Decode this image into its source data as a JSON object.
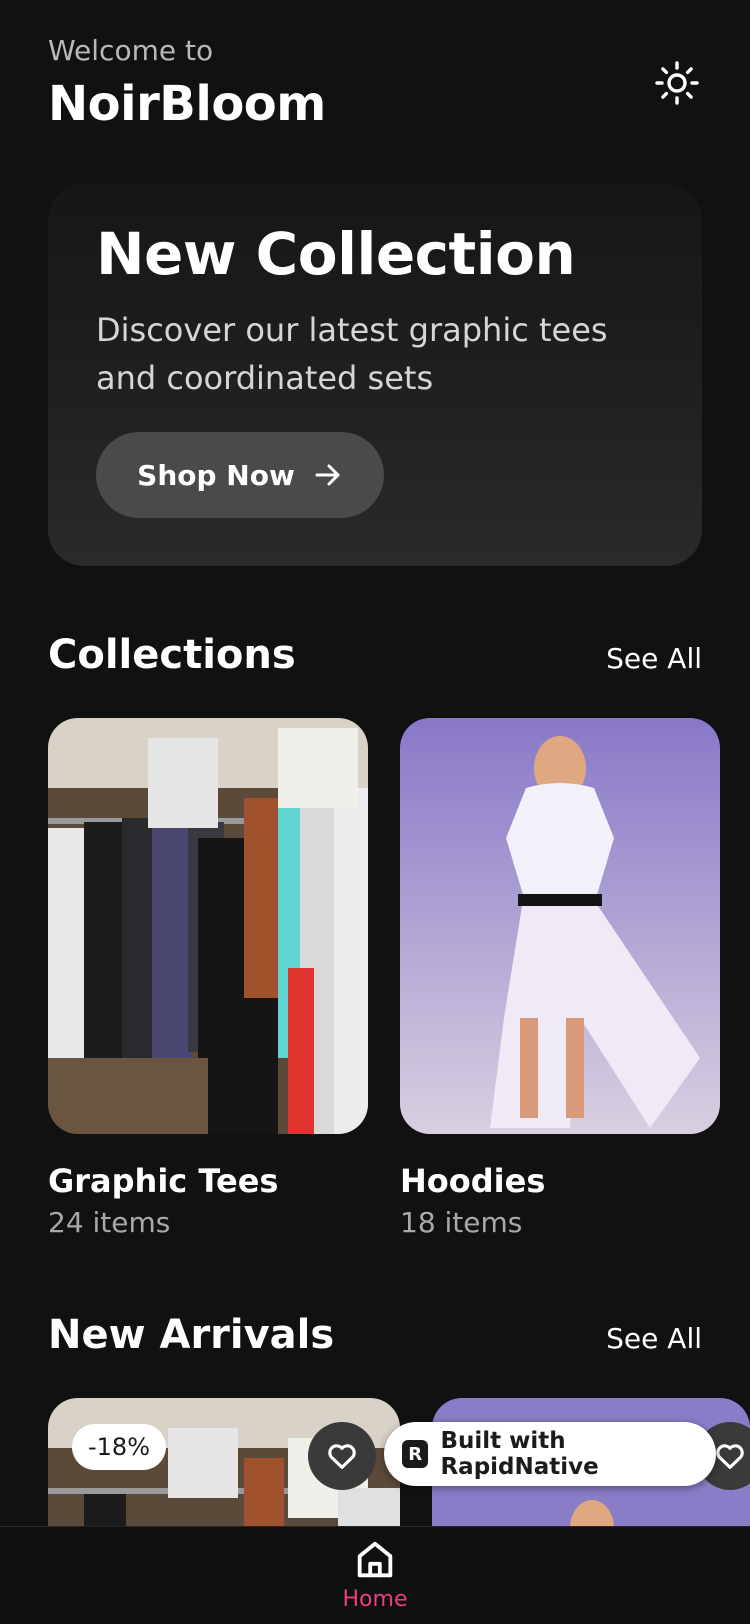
{
  "header": {
    "welcome": "Welcome to",
    "brand": "NoirBloom",
    "theme_icon": "sun-icon"
  },
  "hero": {
    "title": "New Collection",
    "subtitle": "Discover our latest graphic tees and coordinated sets",
    "button_label": "Shop Now",
    "button_icon": "arrow-right-icon"
  },
  "collections": {
    "title": "Collections",
    "see_all": "See All",
    "items": [
      {
        "name": "Graphic Tees",
        "count": "24 items"
      },
      {
        "name": "Hoodies",
        "count": "18 items"
      }
    ]
  },
  "arrivals": {
    "title": "New Arrivals",
    "see_all": "See All",
    "items": [
      {
        "badge": "-18%"
      },
      {
        "badge": ""
      }
    ]
  },
  "rapid": {
    "label": "Built with RapidNative",
    "logo": "R"
  },
  "tabbar": {
    "home_label": "Home"
  },
  "colors": {
    "background": "#111112",
    "accent": "#e8407f",
    "button": "#4a4a4a"
  }
}
